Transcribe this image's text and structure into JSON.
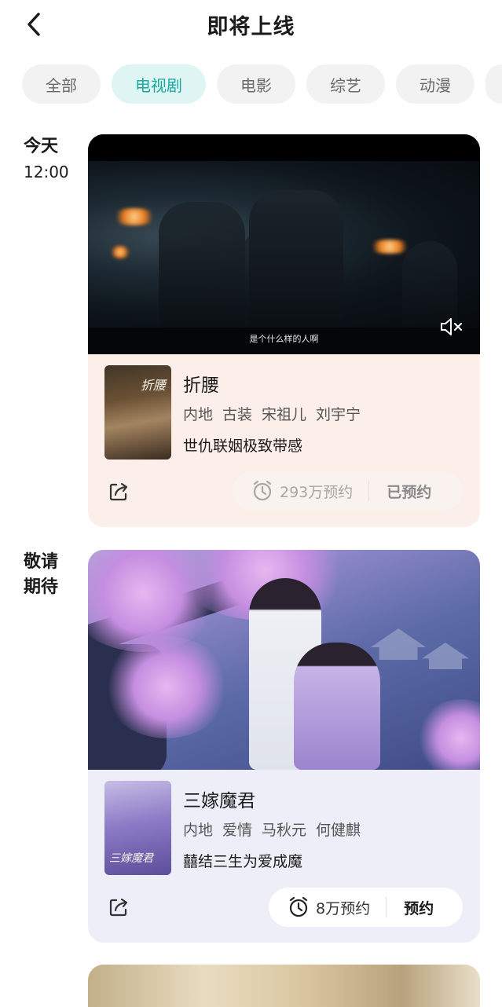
{
  "header": {
    "title": "即将上线"
  },
  "tabs": [
    {
      "label": "全部",
      "active": false
    },
    {
      "label": "电视剧",
      "active": true
    },
    {
      "label": "电影",
      "active": false
    },
    {
      "label": "综艺",
      "active": false
    },
    {
      "label": "动漫",
      "active": false
    }
  ],
  "colors": {
    "accent": "#19a9a0",
    "accent_bg": "#dff5f3",
    "card1_bg": "#fcefe9",
    "card2_bg": "#eeeef9"
  },
  "sections": [
    {
      "label": "今天",
      "time": "12:00"
    },
    {
      "label": "敬请期待",
      "label_line1": "敬请",
      "label_line2": "期待"
    }
  ],
  "shows": [
    {
      "title": "折腰",
      "tags": [
        "内地",
        "古装",
        "宋祖儿",
        "刘宇宁"
      ],
      "description": "世仇联姻极致带感",
      "reservations": "293万预约",
      "action": "已预约",
      "reserved": true,
      "video_subtitle": "是个什么样的人啊",
      "muted": true,
      "poster_text": "折腰"
    },
    {
      "title": "三嫁魔君",
      "tags": [
        "内地",
        "爱情",
        "马秋元",
        "何健麒"
      ],
      "description": "囍结三生为爱成魔",
      "reservations": "8万预约",
      "action": "预约",
      "reserved": false,
      "poster_text": "三嫁魔君"
    }
  ],
  "icons": {
    "back": "chevron-left-icon",
    "mute": "speaker-muted-icon",
    "share": "share-icon",
    "alarm": "alarm-clock-icon"
  }
}
